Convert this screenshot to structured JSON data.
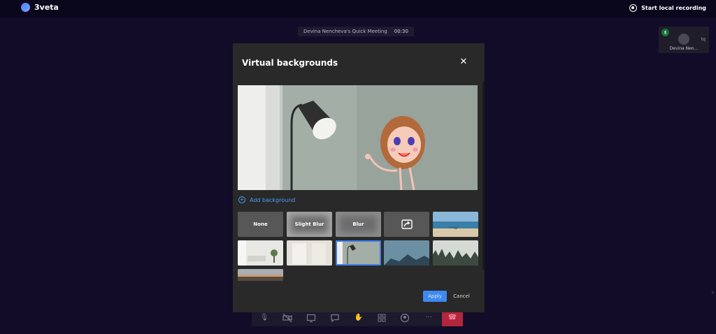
{
  "app": {
    "name": "3veta"
  },
  "topbar": {
    "record_label": "Start local recording"
  },
  "meeting": {
    "title": "Devina Nencheva's Quick Meeting",
    "timer": "00:30"
  },
  "participant": {
    "name": "Devina Nen...",
    "extra": "tq"
  },
  "modal": {
    "title": "Virtual backgrounds",
    "add_background": "Add background",
    "options": {
      "none": "None",
      "slight_blur": "Slight Blur",
      "blur": "Blur"
    },
    "apply": "Apply",
    "cancel": "Cancel"
  },
  "colors": {
    "accent": "#3f88ef",
    "modal_bg": "#292929",
    "page_bg": "#120c28",
    "hangup": "#b3263e"
  }
}
